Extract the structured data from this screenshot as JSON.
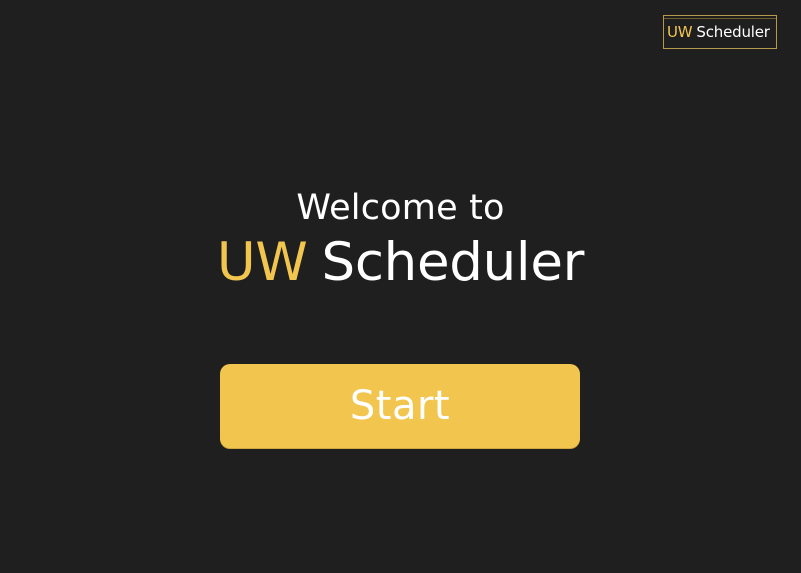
{
  "logo": {
    "uw": "UW",
    "scheduler": "Scheduler"
  },
  "hero": {
    "welcome": "Welcome to",
    "title_uw": "UW",
    "title_scheduler": "Scheduler"
  },
  "actions": {
    "start_label": "Start"
  },
  "colors": {
    "background": "#1f1f1f",
    "accent": "#f2c64e",
    "text": "#ffffff"
  }
}
